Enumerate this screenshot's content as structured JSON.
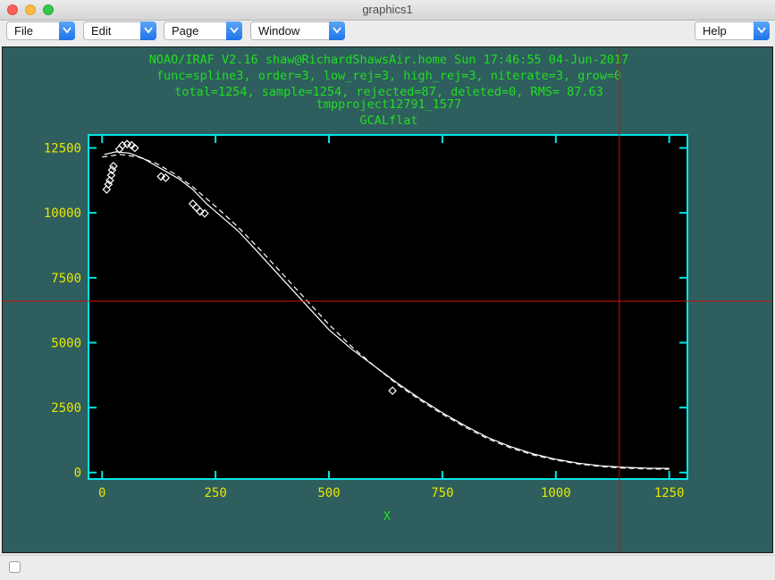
{
  "window": {
    "title": "graphics1"
  },
  "menubar": {
    "file": "File",
    "edit": "Edit",
    "page": "Page",
    "window": "Window",
    "help": "Help"
  },
  "plot": {
    "header": [
      "NOAO/IRAF V2.16 shaw@RichardShawsAir.home Sun 17:46:55 04-Jun-2017",
      "func=spline3, order=3, low_rej=3, high_rej=3, niterate=3, grow=0",
      "total=1254, sample=1254, rejected=87, deleted=0, RMS=  87.63",
      "tmpproject12791_1577",
      "GCALflat"
    ],
    "xlabel": "X",
    "colors": {
      "background": "#000000",
      "frame_bg": "#2e5e5e",
      "axes": "#00e5e5",
      "text": "#22dd22",
      "tick_labels": "#e8e800",
      "data": "#ffffff",
      "crosshair": "#cc1111"
    }
  },
  "chart_data": {
    "type": "line",
    "xlim": [
      -30,
      1290
    ],
    "ylim": [
      -250,
      13000
    ],
    "x_ticks": [
      0,
      250,
      500,
      750,
      1000,
      1250
    ],
    "y_ticks": [
      0,
      2500,
      5000,
      7500,
      10000,
      12500
    ],
    "x_tick_labels": [
      "0",
      "250",
      "500",
      "750",
      "1000",
      "1250"
    ],
    "y_tick_labels": [
      "0",
      "2500",
      "5000",
      "7500",
      "10000",
      "12500"
    ],
    "crosshair": {
      "x": 1140,
      "y": 6600
    },
    "series": [
      {
        "style": "solid",
        "x": [
          5,
          30,
          60,
          90,
          110,
          140,
          170,
          200,
          230,
          260,
          300,
          340,
          400,
          450,
          500,
          550,
          600,
          650,
          700,
          750,
          800,
          850,
          900,
          950,
          1000,
          1050,
          1100,
          1150,
          1200,
          1250
        ],
        "y": [
          12250,
          12350,
          12300,
          12100,
          11900,
          11600,
          11300,
          10900,
          10350,
          9900,
          9300,
          8550,
          7400,
          6450,
          5500,
          4750,
          4100,
          3450,
          2850,
          2300,
          1800,
          1350,
          1000,
          720,
          510,
          360,
          260,
          200,
          170,
          160
        ]
      },
      {
        "style": "dashed",
        "x": [
          0,
          40,
          80,
          120,
          160,
          200,
          250,
          300,
          350,
          400,
          450,
          500,
          550,
          600,
          650,
          700,
          750,
          800,
          850,
          900,
          950,
          1000,
          1050,
          1100,
          1150,
          1200,
          1250
        ],
        "y": [
          12150,
          12250,
          12150,
          11900,
          11500,
          11000,
          10250,
          9450,
          8550,
          7600,
          6650,
          5700,
          4850,
          4100,
          3400,
          2800,
          2250,
          1750,
          1300,
          950,
          680,
          480,
          330,
          230,
          170,
          140,
          130
        ]
      }
    ],
    "rejected_points": [
      {
        "x": 10,
        "y": 10900
      },
      {
        "x": 14,
        "y": 11100
      },
      {
        "x": 17,
        "y": 11250
      },
      {
        "x": 20,
        "y": 11450
      },
      {
        "x": 22,
        "y": 11650
      },
      {
        "x": 25,
        "y": 11800
      },
      {
        "x": 38,
        "y": 12450
      },
      {
        "x": 45,
        "y": 12600
      },
      {
        "x": 55,
        "y": 12650
      },
      {
        "x": 65,
        "y": 12600
      },
      {
        "x": 72,
        "y": 12500
      },
      {
        "x": 130,
        "y": 11400
      },
      {
        "x": 140,
        "y": 11350
      },
      {
        "x": 200,
        "y": 10350
      },
      {
        "x": 208,
        "y": 10200
      },
      {
        "x": 216,
        "y": 10050
      },
      {
        "x": 226,
        "y": 9980
      },
      {
        "x": 640,
        "y": 3150
      }
    ]
  }
}
